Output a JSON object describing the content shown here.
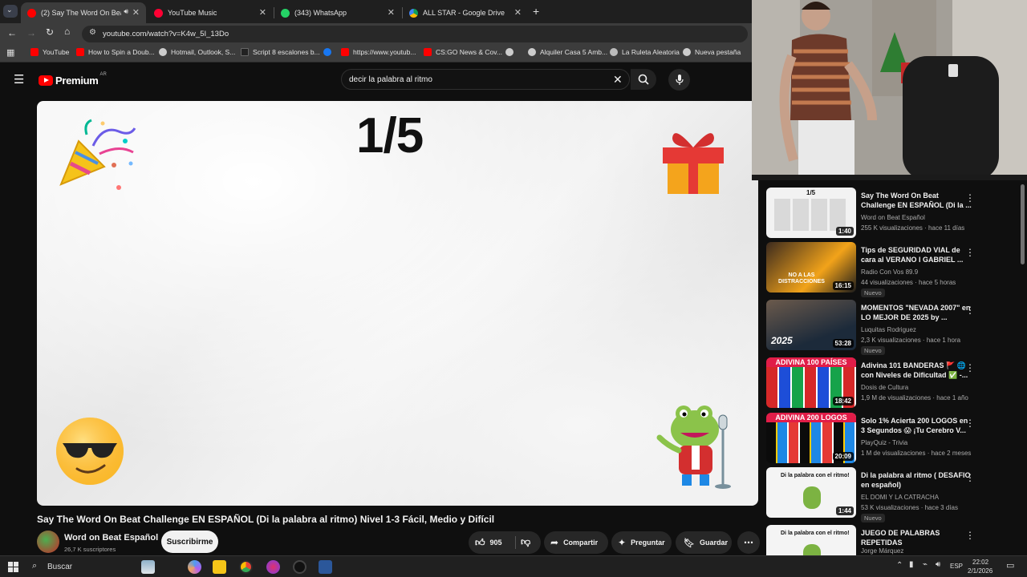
{
  "browser": {
    "tabs": [
      {
        "label": "(2) Say The Word On Beat C",
        "active": true
      },
      {
        "label": "YouTube Music",
        "active": false
      },
      {
        "label": "(343) WhatsApp",
        "active": false
      },
      {
        "label": "ALL STAR - Google Drive",
        "active": false
      }
    ],
    "url": "youtube.com/watch?v=K4w_5I_13Do",
    "bookmarks": [
      "YouTube",
      "How to Spin a Doub...",
      "Hotmail, Outlook, S...",
      "Script 8 escalones b...",
      "",
      "https://www.youtub...",
      "CS:GO News & Cov...",
      "",
      "Alquiler Casa 5 Amb...",
      "La Ruleta Aleatoria",
      "Nueva pestaña"
    ]
  },
  "masthead": {
    "logo_text": "Premium",
    "region": "AR",
    "search_value": "decir la palabra al ritmo"
  },
  "player": {
    "counter": "1/5"
  },
  "video": {
    "title": "Say The Word On Beat Challenge EN ESPAÑOL (Di la palabra al ritmo) Nivel 1-3 Fácil, Medio y Difícil",
    "channel": "Word on Beat Español",
    "subscribers": "26,7 K suscriptores",
    "subscribe_label": "Suscribirme",
    "likes": "905",
    "share_label": "Compartir",
    "ask_label": "Preguntar",
    "save_label": "Guardar"
  },
  "recommendations": [
    {
      "title": "Say The Word On Beat Challenge EN ESPAÑOL (Di la ...",
      "channel": "Word on Beat Español",
      "meta": "255 K visualizaciones · hace 11 días",
      "duration": "1:40",
      "badge": "",
      "thumb_text": "1/5"
    },
    {
      "title": "Tips de SEGURIDAD VIAL de cara al VERANO I GABRIEL ...",
      "channel": "Radio Con Vos 89.9",
      "meta": "44 visualizaciones · hace 5 horas",
      "duration": "16:15",
      "badge": "Nuevo",
      "thumb_text": "NO A LAS DISTRACCIONES"
    },
    {
      "title": "MOMENTOS \"NEVADA 2007\" en LO MEJOR DE 2025 by ...",
      "channel": "Luquitas Rodriguez",
      "meta": "2,3 K visualizaciones · hace 1 hora",
      "duration": "53:28",
      "badge": "Nuevo",
      "thumb_text": "2025"
    },
    {
      "title": "Adivina 101 BANDERAS 🚩 🌐 con Niveles de Dificultad ✅ -...",
      "channel": "Dosis de Cultura",
      "meta": "1,9 M de visualizaciones · hace 1 año",
      "duration": "18:42",
      "badge": "",
      "thumb_text": "ADIVINA 100 PAÍSES"
    },
    {
      "title": "Solo 1% Acierta 200 LOGOS en 3 Segundos 😱 ¡Tu Cerebro V...",
      "channel": "PlayQuiz - Trivia",
      "meta": "1 M de visualizaciones · hace 2 meses",
      "duration": "20:09",
      "badge": "",
      "thumb_text": "ADIVINA 200 LOGOS"
    },
    {
      "title": "Di la palabra al ritmo ( DESAFIO en español)",
      "channel": "EL DOMI Y LA CATRACHA",
      "meta": "53 K visualizaciones · hace 3 días",
      "duration": "1:44",
      "badge": "Nuevo",
      "thumb_text": "Di la palabra con el ritmo!"
    },
    {
      "title": "JUEGO DE PALABRAS REPETIDAS",
      "channel": "Jorge Márquez",
      "meta": "",
      "duration": "",
      "badge": "",
      "thumb_text": "Di la palabra con el ritmo!"
    }
  ],
  "taskbar": {
    "search_label": "Buscar",
    "lang": "ESP",
    "time": "22:02",
    "date": "2/1/2026"
  },
  "colors": {
    "youtube_red": "#ff0000",
    "bg": "#0f0f0f",
    "chrome_toolbar": "#3c3c3c"
  }
}
